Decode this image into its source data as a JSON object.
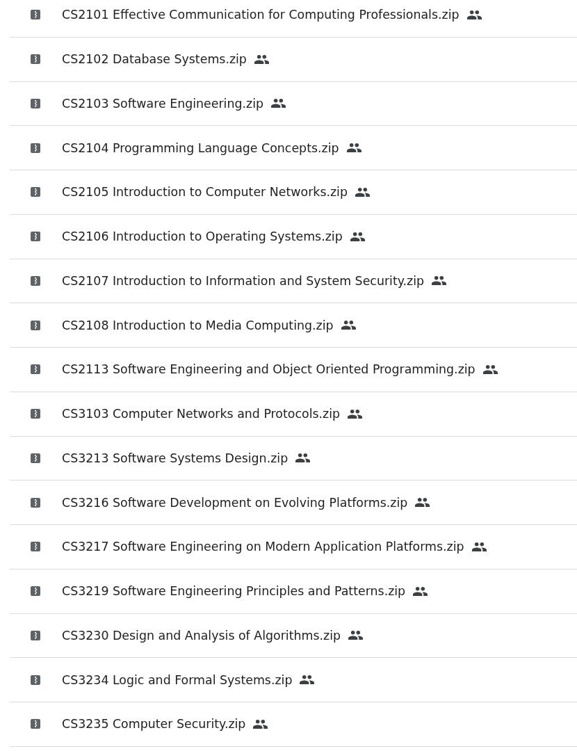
{
  "files": [
    {
      "name": "CS2101 Effective Communication for Computing Professionals.zip",
      "shared": true
    },
    {
      "name": "CS2102 Database Systems.zip",
      "shared": true
    },
    {
      "name": "CS2103 Software Engineering.zip",
      "shared": true
    },
    {
      "name": "CS2104 Programming Language Concepts.zip",
      "shared": true
    },
    {
      "name": "CS2105 Introduction to Computer Networks.zip",
      "shared": true
    },
    {
      "name": "CS2106 Introduction to Operating Systems.zip",
      "shared": true
    },
    {
      "name": "CS2107 Introduction to Information and System Security.zip",
      "shared": true
    },
    {
      "name": "CS2108 Introduction to Media Computing.zip",
      "shared": true
    },
    {
      "name": "CS2113 Software Engineering and Object Oriented Programming.zip",
      "shared": true
    },
    {
      "name": "CS3103 Computer Networks and Protocols.zip",
      "shared": true
    },
    {
      "name": "CS3213 Software Systems Design.zip",
      "shared": true
    },
    {
      "name": "CS3216 Software Development on Evolving Platforms.zip",
      "shared": true
    },
    {
      "name": "CS3217 Software Engineering on Modern Application Platforms.zip",
      "shared": true
    },
    {
      "name": "CS3219 Software Engineering Principles and Patterns.zip",
      "shared": true
    },
    {
      "name": "CS3230 Design and Analysis of Algorithms.zip",
      "shared": true
    },
    {
      "name": "CS3234 Logic and Formal Systems.zip",
      "shared": true
    },
    {
      "name": "CS3235 Computer Security.zip",
      "shared": true
    }
  ]
}
